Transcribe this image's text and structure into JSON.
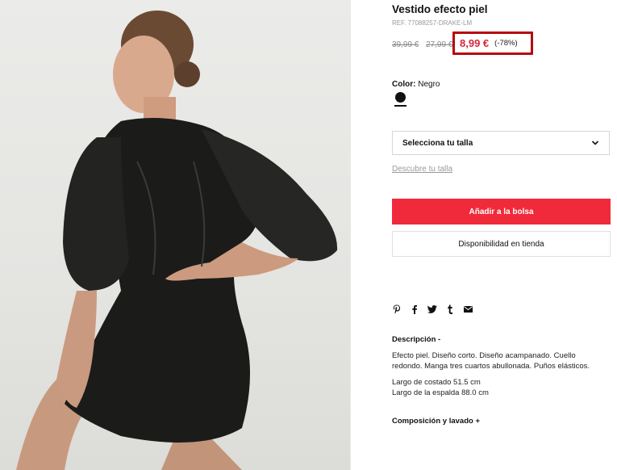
{
  "product": {
    "title": "Vestido efecto piel",
    "ref": "REF. 77088257-DRAKE-LM",
    "old_price_1": "39,99 €",
    "old_price_2": "27,99 €",
    "price": "8,99 €",
    "discount": "(-78%)",
    "color_label": "Color:",
    "color_value": "Negro",
    "swatch_color": "#111111",
    "accent_color": "#f02a3a",
    "highlight_border_color": "#b50810"
  },
  "size": {
    "select_label": "Selecciona tu talla",
    "guide_link": "Descubre tu talla"
  },
  "actions": {
    "add_to_bag": "Añadir a la bolsa",
    "store_availability": "Disponibilidad en tienda"
  },
  "share_icons": [
    "pinterest-icon",
    "facebook-icon",
    "twitter-icon",
    "tumblr-icon",
    "email-icon"
  ],
  "description": {
    "title": "Descripción  -",
    "text": "Efecto piel. Diseño corto. Diseño acampanado. Cuello redondo. Manga tres cuartos abullonada. Puños elásticos.",
    "measure_1": "Largo de costado 51.5 cm",
    "measure_2": "Largo de la espalda 88.0 cm"
  },
  "composition": {
    "title": "Composición y lavado  +"
  }
}
